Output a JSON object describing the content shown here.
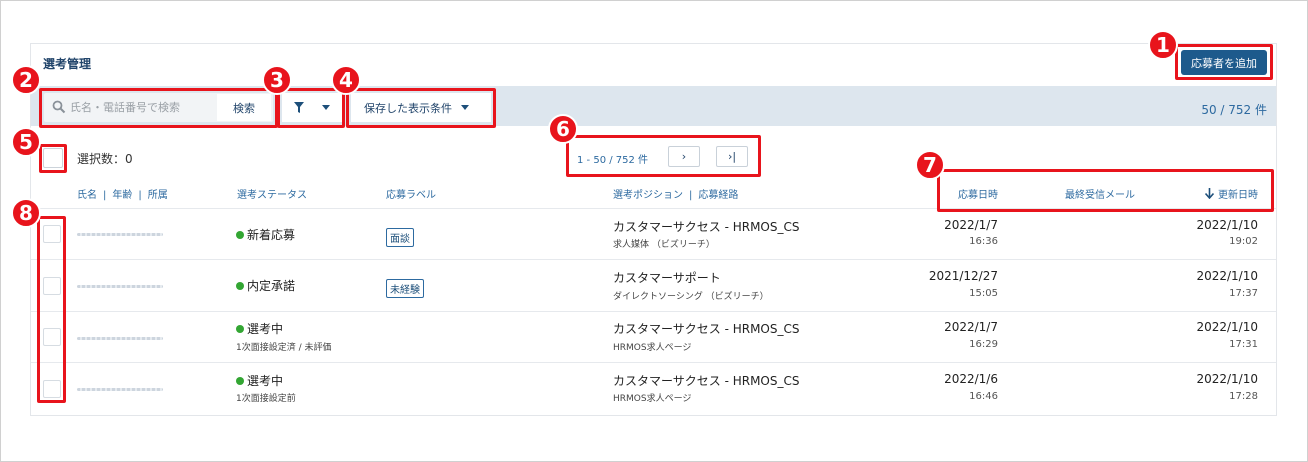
{
  "page": {
    "title": "選考管理"
  },
  "actions": {
    "add_applicant": "応募者を追加"
  },
  "toolbar": {
    "search_placeholder": "氏名・電話番号で検索",
    "search_button": "検索",
    "saved_conditions": "保存した表示条件",
    "total_count": "50 / 752 件"
  },
  "selection": {
    "label": "選択数：0"
  },
  "pager": {
    "range": "1 - 50 / 752 件",
    "next": "›",
    "last": "›|"
  },
  "columns": {
    "name": "氏名",
    "age": "年齢",
    "affiliation": "所属",
    "status": "選考ステータス",
    "label": "応募ラベル",
    "position": "選考ポジション",
    "route": "応募経路",
    "applied_at": "応募日時",
    "last_mail": "最終受信メール",
    "updated_at": "更新日時"
  },
  "rows": [
    {
      "status": "新着応募",
      "status_sub": "",
      "label": "面談",
      "position": "カスタマーサクセス - HRMOS_CS",
      "route": "求人媒体 （ビズリーチ）",
      "applied_date": "2022/1/7",
      "applied_time": "16:36",
      "updated_date": "2022/1/10",
      "updated_time": "19:02"
    },
    {
      "status": "内定承諾",
      "status_sub": "",
      "label": "未経験",
      "position": "カスタマーサポート",
      "route": "ダイレクトソーシング （ビズリーチ）",
      "applied_date": "2021/12/27",
      "applied_time": "15:05",
      "updated_date": "2022/1/10",
      "updated_time": "17:37"
    },
    {
      "status": "選考中",
      "status_sub": "1次面接設定済 / 未評価",
      "label": "",
      "position": "カスタマーサクセス - HRMOS_CS",
      "route": "HRMOS求人ページ",
      "applied_date": "2022/1/7",
      "applied_time": "16:29",
      "updated_date": "2022/1/10",
      "updated_time": "17:31"
    },
    {
      "status": "選考中",
      "status_sub": "1次面接設定前",
      "label": "",
      "position": "カスタマーサクセス - HRMOS_CS",
      "route": "HRMOS求人ページ",
      "applied_date": "2022/1/6",
      "applied_time": "16:46",
      "updated_date": "2022/1/10",
      "updated_time": "17:28"
    }
  ],
  "annotations": [
    "1",
    "2",
    "3",
    "4",
    "5",
    "6",
    "7",
    "8"
  ],
  "colors": {
    "accent": "#1d5a8c",
    "annotation": "#e8141c",
    "status_dot": "#33a633",
    "toolbar_bg": "#dde6ee"
  }
}
